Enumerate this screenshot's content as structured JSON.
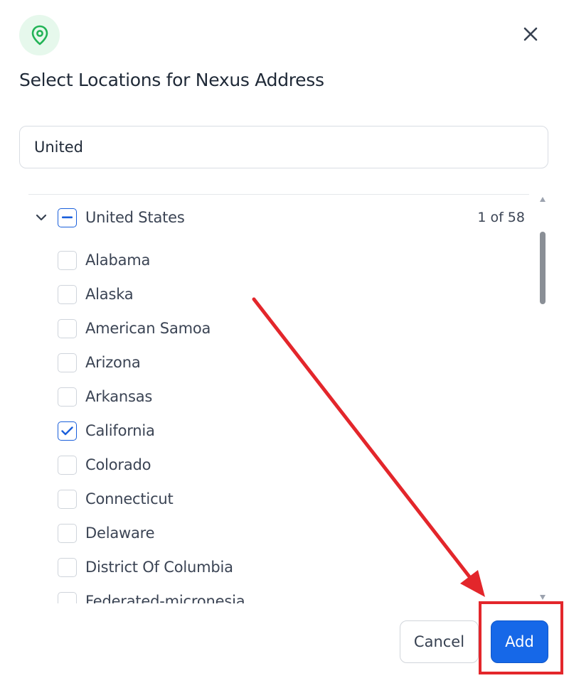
{
  "dialog": {
    "title": "Select Locations for Nexus Address",
    "icon": "location-pin-icon",
    "close_icon": "close-icon"
  },
  "search": {
    "value": "United"
  },
  "group": {
    "name": "United States",
    "count_text": "1 of 58",
    "state": "indeterminate",
    "expanded": true
  },
  "items": [
    {
      "label": "Alabama",
      "checked": false
    },
    {
      "label": "Alaska",
      "checked": false
    },
    {
      "label": "American Samoa",
      "checked": false
    },
    {
      "label": "Arizona",
      "checked": false
    },
    {
      "label": "Arkansas",
      "checked": false
    },
    {
      "label": "California",
      "checked": true
    },
    {
      "label": "Colorado",
      "checked": false
    },
    {
      "label": "Connecticut",
      "checked": false
    },
    {
      "label": "Delaware",
      "checked": false
    },
    {
      "label": "District Of Columbia",
      "checked": false
    },
    {
      "label": "Federated-micronesia",
      "checked": false
    }
  ],
  "footer": {
    "cancel_label": "Cancel",
    "add_label": "Add"
  },
  "colors": {
    "accent": "#1668e8",
    "icon_green": "#22b356",
    "icon_bg": "#e6f8ec",
    "annotation_red": "#e3262b"
  }
}
